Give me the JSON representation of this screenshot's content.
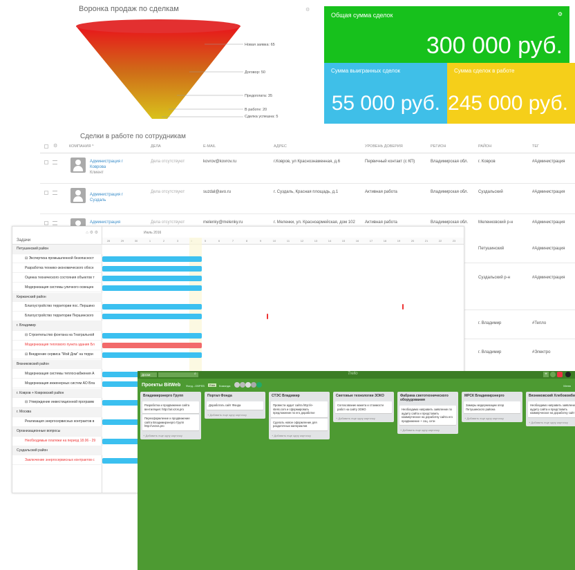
{
  "funnel": {
    "title": "Воронка продаж по сделкам",
    "labels": [
      "Новая заявка: 65",
      "Договор: 50",
      "Предоплата: 35",
      "В работе: 20",
      "Сделка успешна: 5"
    ],
    "colors": [
      "#e8151b",
      "#d9471a",
      "#cf6e18",
      "#c99416",
      "#d9c21c"
    ]
  },
  "tiles": {
    "total": {
      "title": "Общая сумма сделок",
      "value": "300 000 руб.",
      "color": "#17c11c"
    },
    "won": {
      "title": "Сумма выигранных сделок",
      "value": "55 000 руб.",
      "color": "#3fbfe8"
    },
    "in_work": {
      "title": "Сумма сделок в работе",
      "value": "245 000 руб.",
      "color": "#f5cf1a"
    }
  },
  "deals_table": {
    "title": "Сделки в работе по сотрудникам",
    "headers": [
      "Компания ^",
      "Дела",
      "E-mail",
      "Адрес",
      "Уровень доверия",
      "Регион",
      "Район",
      "Тег"
    ],
    "rows": [
      {
        "company": "Администрация г Коврова",
        "sub": "Клиент",
        "tasks": "Дела отсутствуют",
        "email": "kovrov@kovrov.ru",
        "address": "г.Ковров, ул Краснознаменная, д.6",
        "trust": "Первичный контакт (с КП)",
        "region": "Владимирская обл.",
        "district": "г. Ковров",
        "tag": "#Администрация"
      },
      {
        "company": "Администрация г Суздаль",
        "sub": "",
        "tasks": "Дела отсутствуют",
        "email": "suzdal@avo.ru",
        "address": "г. Суздаль, Красная площадь, д.1",
        "trust": "Активная работа",
        "region": "Владимирская обл.",
        "district": "Суздальский",
        "tag": "#Администрация"
      },
      {
        "company": "Администрация",
        "sub": "",
        "tasks": "Дела отсутствуют",
        "email": "melenky@melenky.ru",
        "address": "г. Меленки, ул. Красноармейская, дом 102",
        "trust": "Активная работа",
        "region": "Владимирская обл.",
        "district": "Меленковский р-н",
        "tag": "#Администрация"
      }
    ],
    "extra_rows": [
      {
        "district": "Петушинский",
        "tag": "#Администрация"
      },
      {
        "district": "Суздальский р-н",
        "tag": "#Администрация"
      },
      {
        "district": "г. Владимир",
        "tag": "#Тепло"
      },
      {
        "district": "г. Владимир",
        "tag": "#Электро"
      }
    ]
  },
  "gantt": {
    "header_label": "Задачи",
    "month": "Июль 2016",
    "days": [
      "28",
      "29",
      "30",
      "1",
      "2",
      "3",
      "4",
      "5",
      "6",
      "7",
      "8",
      "9",
      "10",
      "11",
      "12",
      "13",
      "14",
      "15",
      "16",
      "17",
      "18",
      "19",
      "20",
      "21",
      "22",
      "23"
    ],
    "rows": [
      {
        "text": "Петушинский район",
        "kind": "group"
      },
      {
        "text": "⊟ Экспертиза промышленной безопасност",
        "kind": "task"
      },
      {
        "text": "Разработка технико-экономического обосн",
        "kind": "task"
      },
      {
        "text": "Оценка технического состояния объектов т",
        "kind": "task"
      },
      {
        "text": "Модернизация системы уличного освещен",
        "kind": "task"
      },
      {
        "text": "Киржачский район",
        "kind": "group"
      },
      {
        "text": "Благоустройство территории пос. Першино",
        "kind": "task"
      },
      {
        "text": "Благоустройство территории Першинского",
        "kind": "task"
      },
      {
        "text": "г. Владимир",
        "kind": "group"
      },
      {
        "text": "⊟ Строительство фонтана на Театральной",
        "kind": "task"
      },
      {
        "text": "Модернизация теплового пункта здания Бл",
        "kind": "task-red"
      },
      {
        "text": "⊟ Внедрение сервиса \"Мой Дом\" на терри",
        "kind": "task"
      },
      {
        "text": "Вязниковский район",
        "kind": "group"
      },
      {
        "text": "Модернизация системы теплоснабжения А",
        "kind": "task"
      },
      {
        "text": "Модернизация инженерных систем АО Вла",
        "kind": "task"
      },
      {
        "text": "г. Ковров + Ковровский район",
        "kind": "group"
      },
      {
        "text": "⊟ Утверждение инвестиционной программ",
        "kind": "task"
      },
      {
        "text": "г. Москва",
        "kind": "group"
      },
      {
        "text": "Реализация энергосервисных контрактов в",
        "kind": "task"
      },
      {
        "text": "Организационные вопросы",
        "kind": "group"
      },
      {
        "text": "Необходимые платежи на период 18.06 - 29",
        "kind": "task-red"
      },
      {
        "text": "Суздальский район",
        "kind": "group"
      },
      {
        "text": "Заключение энергосервисных контрактов с",
        "kind": "task-red"
      }
    ]
  },
  "trello": {
    "search": "Доски",
    "brand": "Trello",
    "board": "Проекты BitWeb",
    "team": "Фонд...ОВРЕВ",
    "team_chip": "Free",
    "team_label": "Команда",
    "menu": "Меню",
    "add_card": "+ Добавить еще одну карточку",
    "lists": [
      {
        "title": "Владимирэнерго Групп",
        "cards": [
          "Разработка и продвижение сайта вентиляция: http://air.vzos.pro",
          "Переоформление и продвижение сайта Владимирэнерго Групп http://vezos.pro"
        ]
      },
      {
        "title": "Портал Фонда",
        "cards": [
          "Доработать сайт Фонда"
        ]
      },
      {
        "title": "СТЭС Владимир",
        "cards": [
          "Провести аудит сайта http://e-stess.com и сформировать предложение по его доработке",
          "Сделать новое оформление для раздаточных материалов"
        ]
      },
      {
        "title": "Световые технологии ЗОКО",
        "cards": [
          "Согласование макета и стоимости работ на сайту ЗОКО"
        ]
      },
      {
        "title": "Фабрика светотехнического оборудования",
        "cards": [
          "Необходимо направить заявление по аудиту сайта и представить коммерческое на доработку сайта его продвижение + соц. сети"
        ]
      },
      {
        "title": "МРСК Владимирэнерго",
        "cards": [
          "Замеры модернизации опор Петушинского района"
        ]
      },
      {
        "title": "Вязниковский Хлебокомбинат",
        "cards": [
          "Необходимо направить заявление по аудиту сайта и представить коммерческое на доработку сайт"
        ]
      }
    ]
  }
}
